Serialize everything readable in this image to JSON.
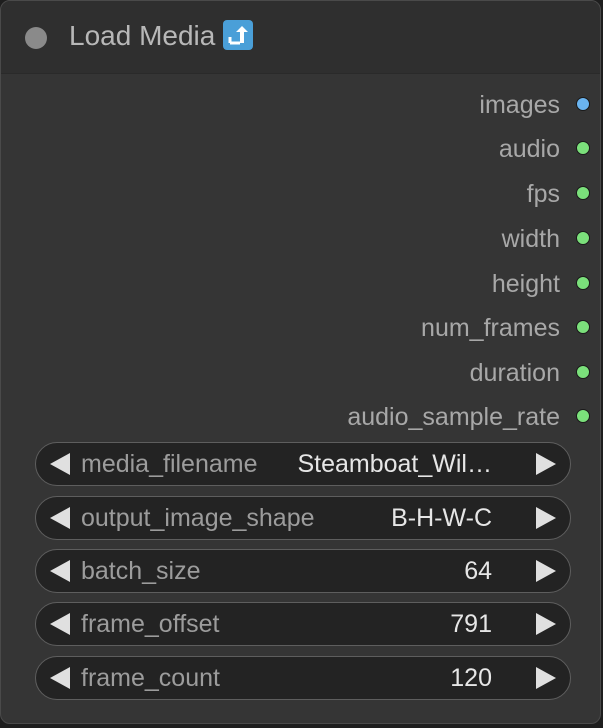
{
  "node": {
    "title": "Load Media",
    "title_icon": "up-arrow-emoji-icon",
    "colors": {
      "body": "#353535",
      "title_bar": "#2f2f2f",
      "status_dot": "#8a8a8a",
      "image_socket": "#6ab4f0",
      "other_socket": "#7be07b"
    }
  },
  "outputs": [
    {
      "label": "images",
      "type": "image"
    },
    {
      "label": "audio",
      "type": "other"
    },
    {
      "label": "fps",
      "type": "other"
    },
    {
      "label": "width",
      "type": "other"
    },
    {
      "label": "height",
      "type": "other"
    },
    {
      "label": "num_frames",
      "type": "other"
    },
    {
      "label": "duration",
      "type": "other"
    },
    {
      "label": "audio_sample_rate",
      "type": "other"
    }
  ],
  "widgets": [
    {
      "label": "media_filename",
      "value": "Steamboat_Wil…"
    },
    {
      "label": "output_image_shape",
      "value": "B-H-W-C"
    },
    {
      "label": "batch_size",
      "value": "64"
    },
    {
      "label": "frame_offset",
      "value": "791"
    },
    {
      "label": "frame_count",
      "value": "120"
    }
  ]
}
